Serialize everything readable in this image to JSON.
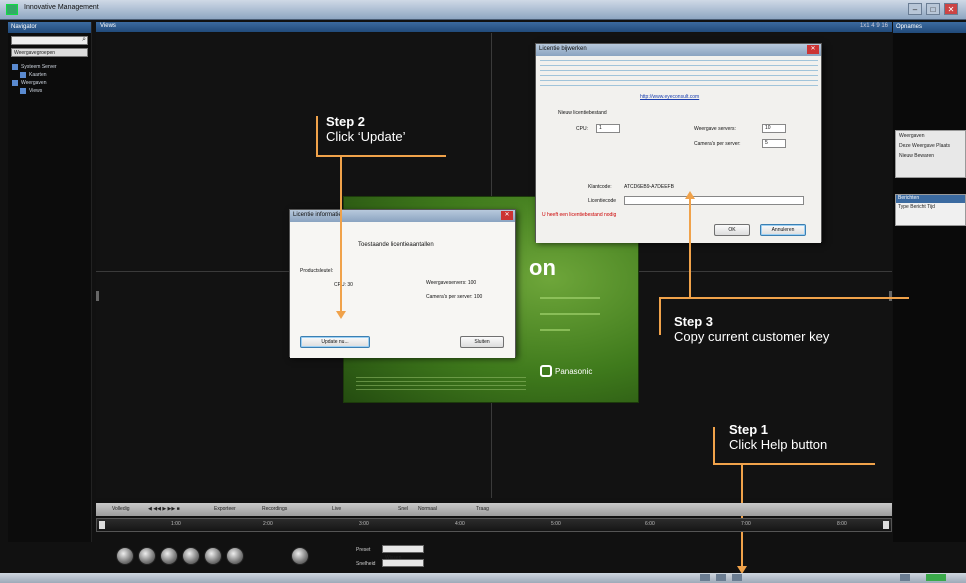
{
  "window": {
    "title": "Innovative Management"
  },
  "left_panel": {
    "header": "Navigator",
    "search_placeholder": "Zoeken",
    "combo_value": "Weergavegroepen",
    "tree": [
      {
        "label": "Systeem Server",
        "level": 1
      },
      {
        "label": "Kaarten",
        "level": 2
      },
      {
        "label": "Weergaven",
        "level": 1
      },
      {
        "label": "Views",
        "level": 2
      }
    ]
  },
  "main_header": {
    "title": "Views",
    "buttons": "1x1  4  9  16"
  },
  "right_panel": {
    "header": "Opnames",
    "box_title": "Weergaven",
    "box_item": "Deze Weergave Plaats",
    "btn_a": "Nieuw",
    "btn_b": "Bewaren",
    "box2_title": "Berichten",
    "box2_cols": "Type  Bericht  Tijd"
  },
  "dialog_license": {
    "title": "Licentie informatie",
    "heading": "Toestaande licentieaantallen",
    "key_label": "Productsleutel:",
    "cpu": "CPU:  30",
    "views": "Weergaveservers:  100",
    "clients": "Camera's per server:  100",
    "update_btn": "Update nu...",
    "close_btn": "Sluiten"
  },
  "dialog_update": {
    "title": "Licentie bijwerken",
    "link": "http://www.eyeconsult.com",
    "section": "Nieuw licentiebestand",
    "cpu_label": "CPU:",
    "cpu_value": "1",
    "servers_label": "Weergave servers:",
    "servers_value": "10",
    "cams_label": "Camera's per server:",
    "cams_value": "5",
    "customer_key_label": "Klantcode:",
    "customer_key": "ATCD6EB9-A7DEEFB",
    "license_label": "Licentiecode",
    "warning": "U heeft een licentiebestand nodig",
    "ok_btn": "OK",
    "cancel_btn": "Annuleren"
  },
  "annotations": {
    "step2_title": "Step 2",
    "step2_text": "Click ‘Update’",
    "step3_title": "Step 3",
    "step3_text": "Copy current customer key",
    "step1_title": "Step 1",
    "step1_text": "Click Help button"
  },
  "timeline_toolbar": {
    "mode": "Volledig",
    "export": "Exporteer",
    "records": "Recordings",
    "live": "Live",
    "speed": "Snel",
    "normal": "Normaal",
    "slow": "Traag"
  },
  "timeline_ticks": [
    "1:00",
    "2:00",
    "3:00",
    "4:00",
    "5:00",
    "6:00",
    "7:00",
    "8:00"
  ],
  "ptz": {
    "preset_label": "Preset",
    "preset_value": "Wissen",
    "speed_label": "Snelheid"
  },
  "colors": {
    "accent": "#f0a24a",
    "brand_green": "#4f8a24",
    "titlebar": "#3b6aa0"
  }
}
